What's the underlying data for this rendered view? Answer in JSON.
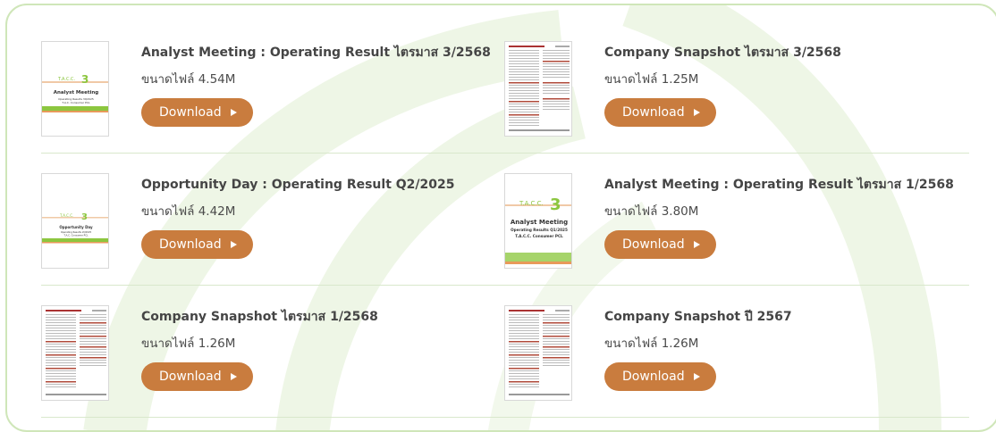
{
  "colors": {
    "button": "#c97c3e",
    "title": "#454545",
    "frame_border": "#cfe6b9",
    "decor_green": "#e4f1d6"
  },
  "download_label": "Download",
  "documents": [
    {
      "title": "Analyst Meeting : Operating Result ไตรมาส 3/2568",
      "size": "ขนาดไฟล์ 4.54M",
      "thumb": "analyst"
    },
    {
      "title": "Company Snapshot ไตรมาส 3/2568",
      "size": "ขนาดไฟล์ 1.25M",
      "thumb": "snapshot"
    },
    {
      "title": "Opportunity Day : Operating Result Q2/2025",
      "size": "ขนาดไฟล์ 4.42M",
      "thumb": "oppday"
    },
    {
      "title": "Analyst Meeting : Operating Result ไตรมาส 1/2568",
      "size": "ขนาดไฟล์ 3.80M",
      "thumb": "analyst-large"
    },
    {
      "title": "Company Snapshot ไตรมาส 1/2568",
      "size": "ขนาดไฟล์ 1.26M",
      "thumb": "snapshot"
    },
    {
      "title": "Company Snapshot ปี 2567",
      "size": "ขนาดไฟล์ 1.26M",
      "thumb": "snapshot"
    }
  ],
  "thumb_text": {
    "analyst": {
      "brand": "T.A.C.C.",
      "decade": "decade",
      "num": "3",
      "heading": "Analyst Meeting",
      "sub1": "Operating Results 3Q2025",
      "sub2": "T.A.C. Consumer PCL"
    },
    "oppday": {
      "brand": "T.A.C.C.",
      "decade": "decade",
      "num": "3",
      "heading": "Opportunity Day",
      "sub1": "Operating Results 2Q2025",
      "sub2": "T.A.C. Consumer PCL"
    },
    "analyst_large": {
      "brand": "T.A.C.C.",
      "decade": "decade",
      "num": "3",
      "heading": "Analyst Meeting",
      "sub1": "Operating Results Q1/2025",
      "sub2": "T.A.C.C. Consumer PCL"
    }
  }
}
